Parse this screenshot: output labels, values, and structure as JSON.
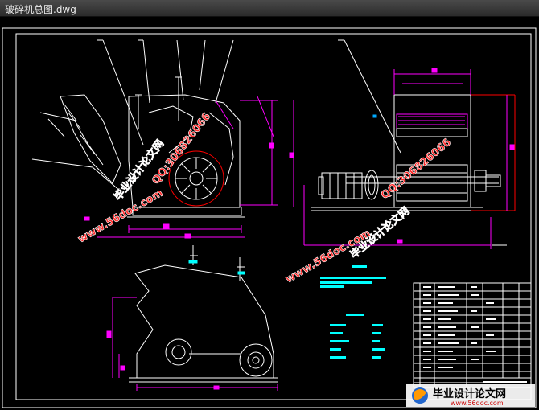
{
  "window": {
    "title": "破碎机总图.dwg"
  },
  "watermarks": [
    {
      "text": "毕业设计论文网"
    },
    {
      "text": "QQ:306826066"
    },
    {
      "text": "www.56doc.com"
    }
  ],
  "logo": {
    "title": "毕业设计论文网",
    "url": "www.56doc.com"
  },
  "colors": {
    "background": "#000000",
    "lines": "#ffffff",
    "dimensions": "#ff00ff",
    "accent": "#00ffff",
    "frame": "#ff0000",
    "watermark": "#ff3333"
  }
}
